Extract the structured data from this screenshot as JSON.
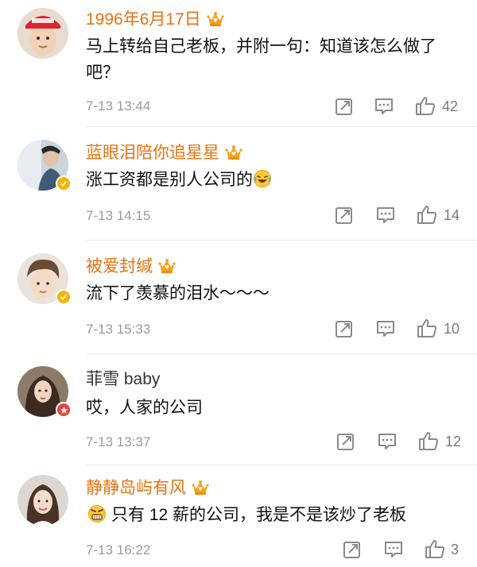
{
  "comments": [
    {
      "username": "1996年6月17日",
      "name_color": "#e8730f",
      "text": "马上转给自己老板，并附一句：知道该怎么做了吧？",
      "time": "7-13 13:44",
      "likes": "42",
      "avatar_label": "Surprise",
      "badge": "none"
    },
    {
      "username": "蓝眼泪陪你追星星",
      "name_color": "#e8730f",
      "text": "涨工资都是别人公司的",
      "time": "7-13 14:15",
      "likes": "14",
      "badge": "verified-yellow"
    },
    {
      "username": "被爱封缄",
      "name_color": "#e8730f",
      "text": "流下了羡慕的泪水～～～",
      "time": "7-13 15:33",
      "likes": "10",
      "badge": "verified-yellow"
    },
    {
      "username": "菲雪 baby",
      "name_color": "#333333",
      "text": "哎，人家的公司",
      "time": "7-13 13:37",
      "likes": "12",
      "badge": "red-star"
    },
    {
      "username": "静静岛屿有风",
      "name_color": "#e8730f",
      "text": "只有 12 薪的公司，我是不是该炒了老板",
      "time": "7-13 16:22",
      "likes": "3",
      "badge": "none"
    }
  ],
  "icons": {
    "crown": "vip-crown-icon",
    "repost": "repost-icon",
    "comment": "comment-icon",
    "like": "thumbs-up-icon",
    "emoji_laugh_cry": "laughing-crying-emoji",
    "emoji_angry": "angry-emoji"
  },
  "colors": {
    "vip_name": "#e8730f",
    "verified": "#f5b400",
    "star_badge": "#e8413c",
    "timestamp": "#9a9a9a"
  }
}
